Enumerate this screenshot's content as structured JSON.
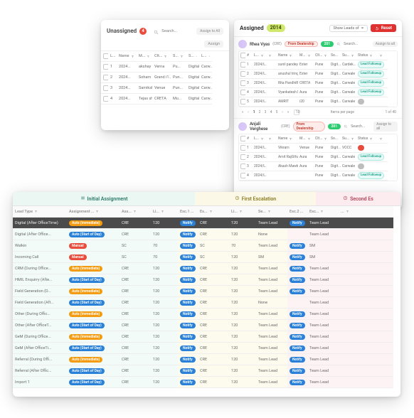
{
  "unassigned": {
    "title": "Unassigned",
    "count": "4",
    "search_placeholder": "Search...",
    "assign_to_all": "Assign to All",
    "assign": "Assign",
    "cols": [
      "#",
      "L...",
      "Name",
      "M...",
      "Clt...",
      "S...",
      "S...",
      "L..."
    ],
    "rows": [
      {
        "n": "1",
        "l": "2024...",
        "name": "akshay ran...",
        "m": "Verna",
        "c": "Pu...",
        "s": "Digital",
        "s2": "Carw..."
      },
      {
        "n": "2",
        "l": "2024...",
        "name": "Soham",
        "m": "Grand i1...",
        "c": "Pun...",
        "s": "Digital",
        "s2": "Carw..."
      },
      {
        "n": "3",
        "l": "2024...",
        "name": "Samiksh pats...",
        "m": "Venue",
        "c": "Pun...",
        "s": "Digital",
        "s2": "Carw..."
      },
      {
        "n": "4",
        "l": "2024...",
        "name": "Tejas shiva...",
        "m": "CRETA",
        "c": "Mu...",
        "s": "Digital",
        "s2": "Carw..."
      }
    ]
  },
  "assigned": {
    "title": "Assigned",
    "count": "2014",
    "show_leads_of": "Show Leads of",
    "reset": "Reset",
    "search_placeholder": "Search...",
    "assign_to_all": "Assign to all",
    "pager": {
      "items_per_page": "Items per page",
      "page_of": "1 of 40"
    },
    "cols": [
      "#",
      "L...",
      "",
      "Name",
      "M...",
      "Clt...",
      "So...",
      "Su...",
      "Status",
      "",
      ""
    ],
    "cres": [
      {
        "name": "Rhea Vyas",
        "role": "(CRE)",
        "role2": "From Dealership",
        "badge": "201",
        "rows": [
          {
            "n": "1",
            "l": "2024/L...",
            "name": "sunil pandey",
            "m": "Exter",
            "c": "Pune",
            "so": "Digit...",
            "su": "Cardek...",
            "status": "Lead Followup",
            "pill": "cyan"
          },
          {
            "n": "2",
            "l": "2024/L...",
            "name": "anushul tring",
            "m": "Exter",
            "c": "Pune",
            "so": "Digit...",
            "su": "Carwale",
            "status": "Lead Followup",
            "pill": "cyan"
          },
          {
            "n": "3",
            "l": "2024/L...",
            "name": "Rita PandhiRao",
            "m": "CRETA",
            "c": "Pune",
            "so": "Digit...",
            "su": "Carwale",
            "status": "Lead Followup",
            "pill": "cyan"
          },
          {
            "n": "4",
            "l": "2024/L...",
            "name": "Vyankatesh M...",
            "m": "Aura",
            "c": "Pune",
            "so": "Digit...",
            "su": "Carwale",
            "status": "Lead Followup",
            "pill": "cyan"
          },
          {
            "n": "5",
            "l": "2024/L...",
            "name": "AMRIT",
            "m": "i20",
            "c": "Pune",
            "so": "Digit...",
            "su": "Carwale",
            "status": "",
            "pill": "gray"
          }
        ]
      },
      {
        "name": "Anjali Verghese",
        "role": "(CRE)",
        "role2": "From Dealership",
        "badge": "201",
        "rows": [
          {
            "n": "1",
            "l": "2024/L...",
            "name": "Vikram",
            "m": "Venue",
            "c": "Pune",
            "so": "Digit...",
            "su": "VOCC",
            "status": "",
            "pill": "red"
          },
          {
            "n": "2",
            "l": "2024/L...",
            "name": "Amit RajGthar",
            "m": "Aura",
            "c": "Pune",
            "so": "Digit...",
            "su": "Carwale",
            "status": "Lead Followup",
            "pill": "cyan"
          },
          {
            "n": "3",
            "l": "2024/L...",
            "name": "Akash Mawkar",
            "m": "Aura",
            "c": "Pune",
            "so": "Digit...",
            "su": "Carwale",
            "status": "",
            "pill": "gray"
          },
          {
            "n": "4",
            "l": "2024/L...",
            "name": "",
            "m": "",
            "c": "Pune",
            "so": "Digit...",
            "su": "Carwale",
            "status": "Lead Followup",
            "pill": "cyan"
          }
        ]
      }
    ]
  },
  "rules": {
    "groups": [
      "Initial Assignment",
      "First Escalation",
      "Second Es"
    ],
    "cols": [
      "Lead Type",
      "Assignment ...",
      "",
      "Ass...",
      "",
      "Li...",
      "",
      "Esc.1 ...",
      "Es...",
      "",
      "Li...",
      "",
      "Se...",
      "",
      "Esc.2 ...",
      "Esc...",
      "",
      "..."
    ],
    "rows": [
      {
        "dark": true,
        "lead": "Digital (After OfficeTime)",
        "mode": "Auto (Immediate)",
        "mclr": "orange",
        "ass": "CRE",
        "li": "120",
        "e1": "Notify",
        "es": "CRE",
        "li2": "120",
        "se": "Team Lead",
        "e2": "Notify",
        "esc": "Team Lead"
      },
      {
        "lead": "Digital (After Office...",
        "mode": "Auto (Start of Day)",
        "mclr": "blue",
        "ass": "CRE",
        "li": "120",
        "e1": "Notify",
        "es": "CRE",
        "li2": "120",
        "se": "None",
        "e2": "",
        "esc": "Team Lead"
      },
      {
        "lead": "Walkin",
        "mode": "Manual",
        "mclr": "red",
        "ass": "SC",
        "li": "70",
        "e1": "Notify",
        "es": "SC",
        "li2": "70",
        "se": "Team Lead",
        "e2": "Notify",
        "esc": "SM"
      },
      {
        "lead": "Incoming Call",
        "mode": "Manual",
        "mclr": "red",
        "ass": "SC",
        "li": "70",
        "e1": "Notify",
        "es": "SC",
        "li2": "120",
        "se": "SM",
        "e2": "Notify",
        "esc": "SM"
      },
      {
        "lead": "CRM (During Office...",
        "mode": "Auto (Immediate)",
        "mclr": "orange",
        "ass": "CRE",
        "li": "120",
        "e1": "Notify",
        "es": "CRE",
        "li2": "120",
        "se": "Team Lead",
        "e2": "Notify",
        "esc": "Team Lead"
      },
      {
        "lead": "HMIL Enquirry (Afte...",
        "mode": "Auto (Start of Day)",
        "mclr": "blue",
        "ass": "CRE",
        "li": "120",
        "e1": "Notify",
        "es": "CRE",
        "li2": "120",
        "se": "Team Lead",
        "e2": "Notify",
        "esc": "Team Lead"
      },
      {
        "lead": "Field Generation (D...",
        "mode": "Auto (Immediate)",
        "mclr": "orange",
        "ass": "CRE",
        "li": "120",
        "e1": "Notify",
        "es": "CRE",
        "li2": "120",
        "se": "Team Lead",
        "e2": "Notify",
        "esc": "Team Lead"
      },
      {
        "lead": "Field Generation (Aft...",
        "mode": "Auto (Start of Day)",
        "mclr": "blue",
        "ass": "CRE",
        "li": "120",
        "e1": "Notify",
        "es": "CRE",
        "li2": "120",
        "se": "None",
        "e2": "",
        "esc": "Team Lead"
      },
      {
        "lead": "Other (During Offic...",
        "mode": "Auto (Immediate)",
        "mclr": "orange",
        "ass": "CRE",
        "li": "120",
        "e1": "Notify",
        "es": "CRE",
        "li2": "120",
        "se": "Team Lead",
        "e2": "Notify",
        "esc": "Team Lead"
      },
      {
        "lead": "Other (After OfficeT...",
        "mode": "Auto (Start of Day)",
        "mclr": "blue",
        "ass": "CRE",
        "li": "120",
        "e1": "Notify",
        "es": "CRE",
        "li2": "120",
        "se": "Team Lead",
        "e2": "Notify",
        "esc": "Team Lead"
      },
      {
        "lead": "GeM (During Office...",
        "mode": "Auto (Immediate)",
        "mclr": "orange",
        "ass": "CRE",
        "li": "120",
        "e1": "Notify",
        "es": "CRE",
        "li2": "120",
        "se": "Team Lead",
        "e2": "Notify",
        "esc": "Team Lead"
      },
      {
        "lead": "GeM (After OfficeTi...",
        "mode": "Auto (Start of Day)",
        "mclr": "blue",
        "ass": "CRE",
        "li": "120",
        "e1": "Notify",
        "es": "CRE",
        "li2": "120",
        "se": "Team Lead",
        "e2": "Notify",
        "esc": "Team Lead"
      },
      {
        "lead": "Referral (During Offi...",
        "mode": "Auto (Immediate)",
        "mclr": "orange",
        "ass": "CRE",
        "li": "120",
        "e1": "Notify",
        "es": "CRE",
        "li2": "120",
        "se": "Team Lead",
        "e2": "Notify",
        "esc": "Team Lead"
      },
      {
        "lead": "Referral (After Offic...",
        "mode": "Auto (Start of Day)",
        "mclr": "blue",
        "ass": "CRE",
        "li": "120",
        "e1": "Notify",
        "es": "CRE",
        "li2": "120",
        "se": "Team Lead",
        "e2": "Notify",
        "esc": "Team Lead"
      },
      {
        "lead": "Import 1",
        "mode": "Auto (Start of Day)",
        "mclr": "blue",
        "ass": "CRE",
        "li": "120",
        "e1": "Notify",
        "es": "CRE",
        "li2": "120",
        "se": "Team Lead",
        "e2": "Notify",
        "esc": "Team Lead"
      }
    ]
  }
}
